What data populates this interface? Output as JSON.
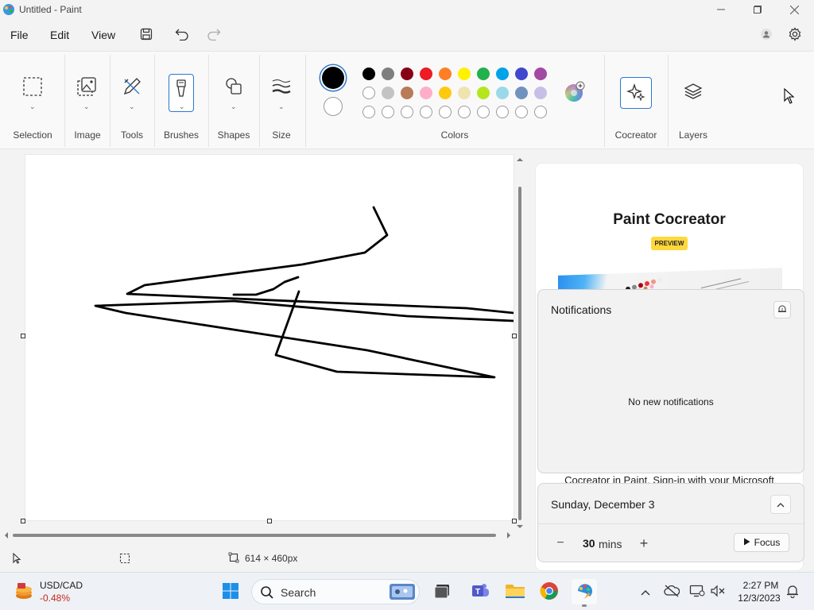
{
  "window": {
    "title": "Untitled - Paint"
  },
  "menu": {
    "file": "File",
    "edit": "Edit",
    "view": "View"
  },
  "ribbon": {
    "groups": {
      "selection": "Selection",
      "image": "Image",
      "tools": "Tools",
      "brushes": "Brushes",
      "shapes": "Shapes",
      "size": "Size",
      "colors": "Colors",
      "cocreator": "Cocreator",
      "layers": "Layers"
    },
    "primary_color": "#000000",
    "secondary_color": "#ffffff",
    "palette_row1": [
      "#000000",
      "#7f7f7f",
      "#880015",
      "#ed1c24",
      "#ff7f27",
      "#fff200",
      "#22b14c",
      "#00a2e8",
      "#3f48cc",
      "#a349a4"
    ],
    "palette_row2": [
      "#ffffff",
      "#c3c3c3",
      "#b97a57",
      "#ffaec9",
      "#ffc90e",
      "#efe4b0",
      "#b5e61d",
      "#99d9ea",
      "#7092be",
      "#c8bfe7"
    ]
  },
  "status": {
    "dimensions": "614 × 460px"
  },
  "cocreator_panel": {
    "title": "Paint Cocreator",
    "badge": "PREVIEW",
    "footer": "Cocreator in Paint. Sign-in with your Microsoft"
  },
  "notifications": {
    "title": "Notifications",
    "empty_text": "No new notifications"
  },
  "calendar": {
    "date": "Sunday, December 3",
    "focus_minutes": "30",
    "focus_unit": "mins",
    "focus_button": "Focus"
  },
  "taskbar": {
    "widget_pair": "USD/CAD",
    "widget_change": "-0.48%",
    "search_label": "Search",
    "time": "2:27 PM",
    "date": "12/3/2023"
  }
}
